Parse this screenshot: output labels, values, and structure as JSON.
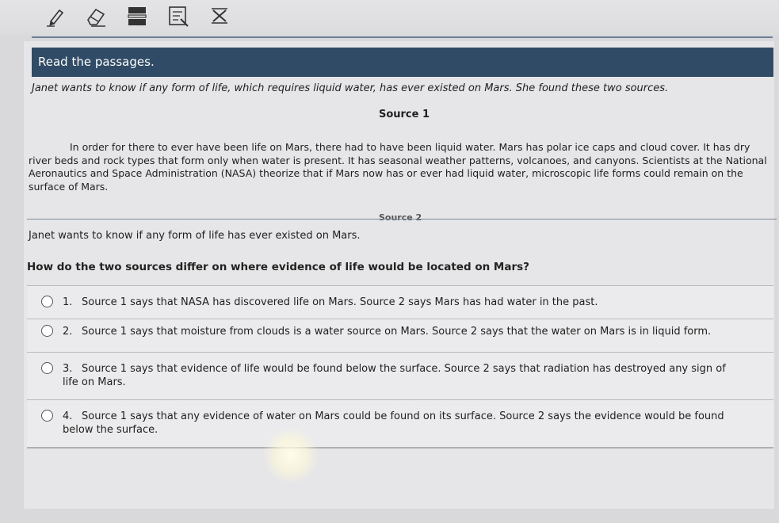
{
  "toolbar": {
    "tools": [
      {
        "name": "pencil-tool",
        "icon": "pencil-icon"
      },
      {
        "name": "eraser-tool",
        "icon": "eraser-icon"
      },
      {
        "name": "line-reader-tool",
        "icon": "line-reader-icon"
      },
      {
        "name": "notepad-tool",
        "icon": "notepad-icon"
      },
      {
        "name": "answer-eliminator-tool",
        "icon": "answer-eliminator-icon"
      }
    ]
  },
  "banner": {
    "text": "Read the passages."
  },
  "intro": "Janet wants to know if any form of life, which requires liquid water, has ever existed on Mars. She found these two sources.",
  "source1": {
    "title": "Source 1",
    "body": "In order for there to ever have been life on Mars, there had to have been liquid water. Mars has polar ice caps and cloud cover. It has dry river beds and rock types that form only when water is present. It has seasonal weather patterns, volcanoes, and canyons. Scientists at the National Aeronautics and Space Administration (NASA) theorize that if Mars now has or ever had liquid water, microscopic life forms could remain on the surface of Mars."
  },
  "source2_peek": "Source 2",
  "question_context": "Janet wants to know if any form of life has ever existed on Mars.",
  "question": "How do the two sources differ on where evidence of life would be located on Mars?",
  "answers": [
    {
      "number": "1.",
      "text": "Source 1 says that NASA has discovered life on Mars. Source 2 says Mars has had water in the past."
    },
    {
      "number": "2.",
      "text": "Source 1 says that moisture from clouds is a water source on Mars. Source 2 says that the water on Mars is in liquid form."
    },
    {
      "number": "3.",
      "text": "Source 1 says that evidence of life would be found below the surface. Source 2 says that radiation has destroyed any sign of life on Mars."
    },
    {
      "number": "4.",
      "text": "Source 1 says that any evidence of water on Mars could be found on its surface. Source 2 says the evidence would be found below the surface."
    }
  ],
  "colors": {
    "banner": "#2f4b66",
    "background": "#d9d9dc"
  }
}
